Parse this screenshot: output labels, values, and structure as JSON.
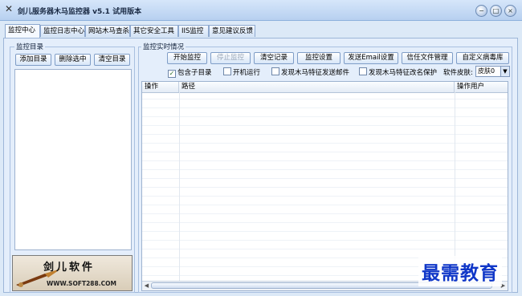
{
  "window": {
    "title": "剑儿服务器木马监控器 v5.1  试用版本",
    "minimize_symbol": "−",
    "restore_symbol": "□",
    "close_symbol": "×"
  },
  "tabs": [
    {
      "label": "监控中心",
      "active": true
    },
    {
      "label": "监控日志中心"
    },
    {
      "label": "网站木马查杀"
    },
    {
      "label": "其它安全工具"
    },
    {
      "label": "IIS监控"
    },
    {
      "label": "意见建议反馈"
    }
  ],
  "directory": {
    "group_title": "监控目录",
    "buttons": {
      "add": "添加目录",
      "delete": "删除选中",
      "clear": "清空目录"
    }
  },
  "monitor": {
    "group_title": "监控实时情况",
    "buttons": {
      "start": "开始监控",
      "stop": "停止监控",
      "clear_log": "清空记录",
      "settings": "监控设置",
      "email": "发送Email设置",
      "trust": "信任文件管理",
      "virus_lib": "自定义病毒库"
    },
    "options": {
      "subdir": {
        "label": "包含子目录",
        "checked": true
      },
      "startup": {
        "label": "开机运行",
        "checked": false
      },
      "send_mail": {
        "label": "发现木马特征发送邮件",
        "checked": false
      },
      "rename": {
        "label": "发现木马特征改名保护",
        "checked": false
      }
    },
    "skin": {
      "label": "软件皮肤:",
      "value": "皮肤0"
    },
    "table": {
      "columns": [
        "操作",
        "路径",
        "操作用户"
      ],
      "rows": []
    }
  },
  "logo": {
    "title": "剑儿软件",
    "url": "WWW.SOFT288.COM"
  },
  "watermark": "最需教育",
  "colors": {
    "accent": "#1037c8",
    "title_bar": "#c6dbf5",
    "panel": "#e4eefb"
  }
}
